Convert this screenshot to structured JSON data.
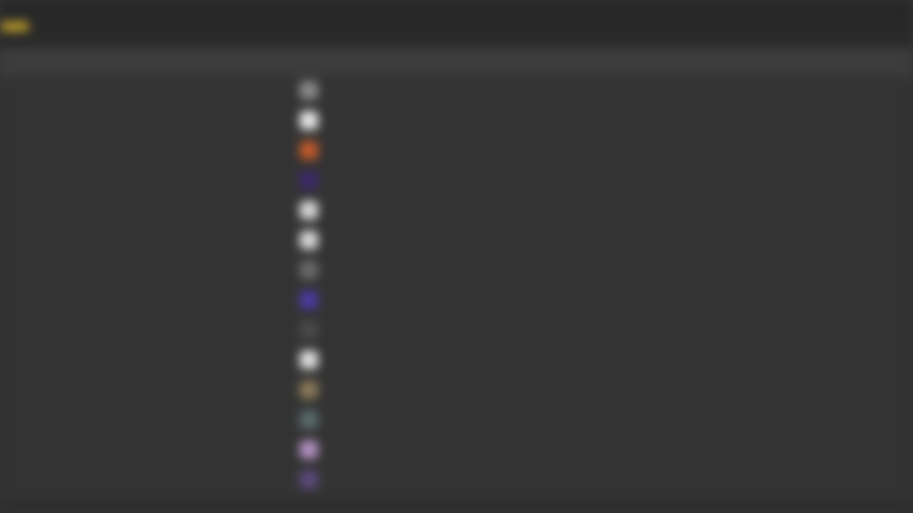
{
  "app": {
    "logo_text": "",
    "accent_color": "#c9a93a",
    "background_color": "#333333"
  },
  "table": {
    "columns": [
      "",
      "",
      ""
    ],
    "rows": [
      {
        "rank": "",
        "emblem_color": "#8a8a8a",
        "emblem_icon": "crest-icon",
        "name": "",
        "name_color": "#c8733a",
        "score": ""
      },
      {
        "rank": "",
        "emblem_color": "#e8e8e8",
        "emblem_icon": "crest-icon",
        "name": "",
        "name_color": "#222222",
        "score": ""
      },
      {
        "rank": "",
        "emblem_color": "#c05a2a",
        "emblem_icon": "crest-icon",
        "name": "",
        "name_color": "#3b6cc8",
        "score": ""
      },
      {
        "rank": "",
        "emblem_color": "#3b2a6a",
        "emblem_icon": "crest-icon",
        "name": "",
        "name_color": "#c040b0",
        "score": ""
      },
      {
        "rank": "",
        "emblem_color": "#d8d8d8",
        "emblem_icon": "crest-icon",
        "name": "",
        "name_color": "#8fa3a3",
        "score": ""
      },
      {
        "rank": "",
        "emblem_color": "#d8d8d8",
        "emblem_icon": "crest-icon",
        "name": "",
        "name_color": "#5c8f3a",
        "score": ""
      },
      {
        "rank": "",
        "emblem_color": "#6a6a6a",
        "emblem_icon": "crest-icon",
        "name": "",
        "name_color": "#c0703a",
        "score": ""
      },
      {
        "rank": "",
        "emblem_color": "#4a3aa0",
        "emblem_icon": "crest-icon",
        "name": "",
        "name_color": "#262626",
        "score": ""
      },
      {
        "rank": "",
        "emblem_color": "#4a4a4a",
        "emblem_icon": "crest-icon",
        "name": "",
        "name_color": "#3a8a3a",
        "score": ""
      },
      {
        "rank": "",
        "emblem_color": "#e0e0e0",
        "emblem_icon": "crest-icon",
        "name": "",
        "name_color": "#3a70b8",
        "score": ""
      },
      {
        "rank": "",
        "emblem_color": "#8a7a5a",
        "emblem_icon": "crest-icon",
        "name": "",
        "name_color": "#b83030",
        "score": ""
      },
      {
        "rank": "",
        "emblem_color": "#5a6a6a",
        "emblem_icon": "crest-icon",
        "name": "",
        "name_color": "#c0a030",
        "score": ""
      },
      {
        "rank": "",
        "emblem_color": "#b090c0",
        "emblem_icon": "crest-icon",
        "name": "",
        "name_color": "#a0b040",
        "score": ""
      },
      {
        "rank": "",
        "emblem_color": "#5a4a7a",
        "emblem_icon": "crest-icon",
        "name": "",
        "name_color": "#c03050",
        "score": ""
      }
    ]
  }
}
